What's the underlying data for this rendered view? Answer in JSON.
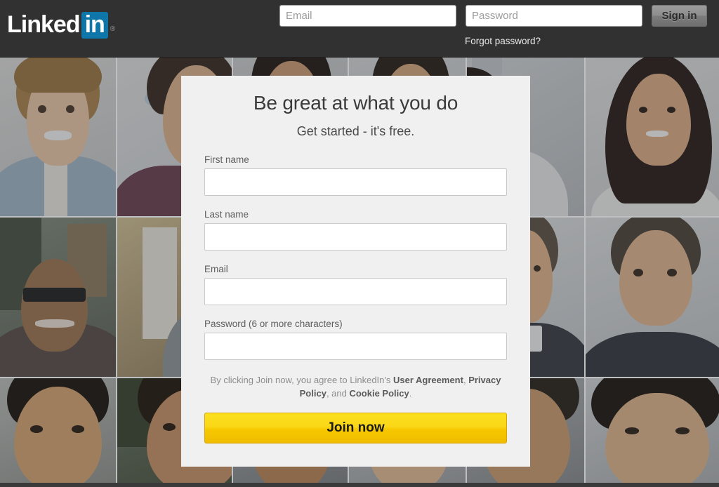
{
  "header": {
    "logo_word": "Linked",
    "logo_in": "in",
    "logo_registered": "®",
    "email_placeholder": "Email",
    "email_value": "",
    "password_placeholder": "Password",
    "password_value": "",
    "signin_label": "Sign in",
    "forgot_password_label": "Forgot password?",
    "bar_color": "#313131",
    "brand_blue": "#0e76a8"
  },
  "signup_card": {
    "heading": "Be great at what you do",
    "subheading": "Get started - it's free.",
    "fields": [
      {
        "label": "First name",
        "value": "",
        "placeholder": "",
        "type": "text",
        "name": "first-name"
      },
      {
        "label": "Last name",
        "value": "",
        "placeholder": "",
        "type": "text",
        "name": "last-name"
      },
      {
        "label": "Email",
        "value": "",
        "placeholder": "",
        "type": "email",
        "name": "email"
      },
      {
        "label": "Password (6 or more characters)",
        "value": "",
        "placeholder": "",
        "type": "password",
        "name": "password"
      }
    ],
    "legal": {
      "prefix": "By clicking Join now, you agree to LinkedIn's ",
      "user_agreement": "User Agreement",
      "sep1": ", ",
      "privacy_policy": "Privacy Policy",
      "sep2": ", and ",
      "cookie_policy": "Cookie Policy",
      "suffix": "."
    },
    "join_label": "Join now",
    "card_bg": "#f0f0f0",
    "join_button_color": "#f7cf00"
  },
  "background": {
    "description": "desaturated photo mosaic of smiling professional portraits",
    "columns": 6,
    "rows": 3
  }
}
